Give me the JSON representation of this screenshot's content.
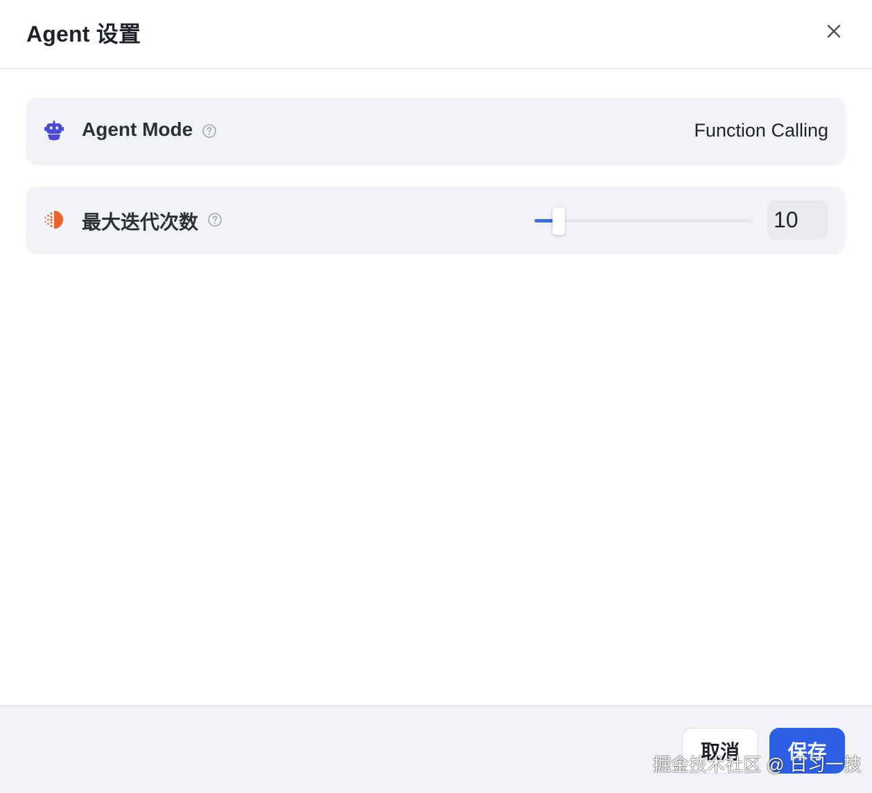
{
  "dialog": {
    "title": "Agent 设置"
  },
  "settings": [
    {
      "icon": "robot-icon",
      "label": "Agent Mode",
      "value": "Function Calling"
    },
    {
      "icon": "iteration-icon",
      "label": "最大迭代次数",
      "slider_fraction": 0.11,
      "value": "10"
    }
  ],
  "footer": {
    "cancel_label": "取消",
    "save_label": "保存"
  },
  "watermark": "掘金技术社区 @ 日习一技",
  "colors": {
    "accent": "#2c5fe6",
    "robot_icon": "#4a48d6",
    "iteration_icon": "#e8642c",
    "card_bg": "#f2f3f6"
  }
}
